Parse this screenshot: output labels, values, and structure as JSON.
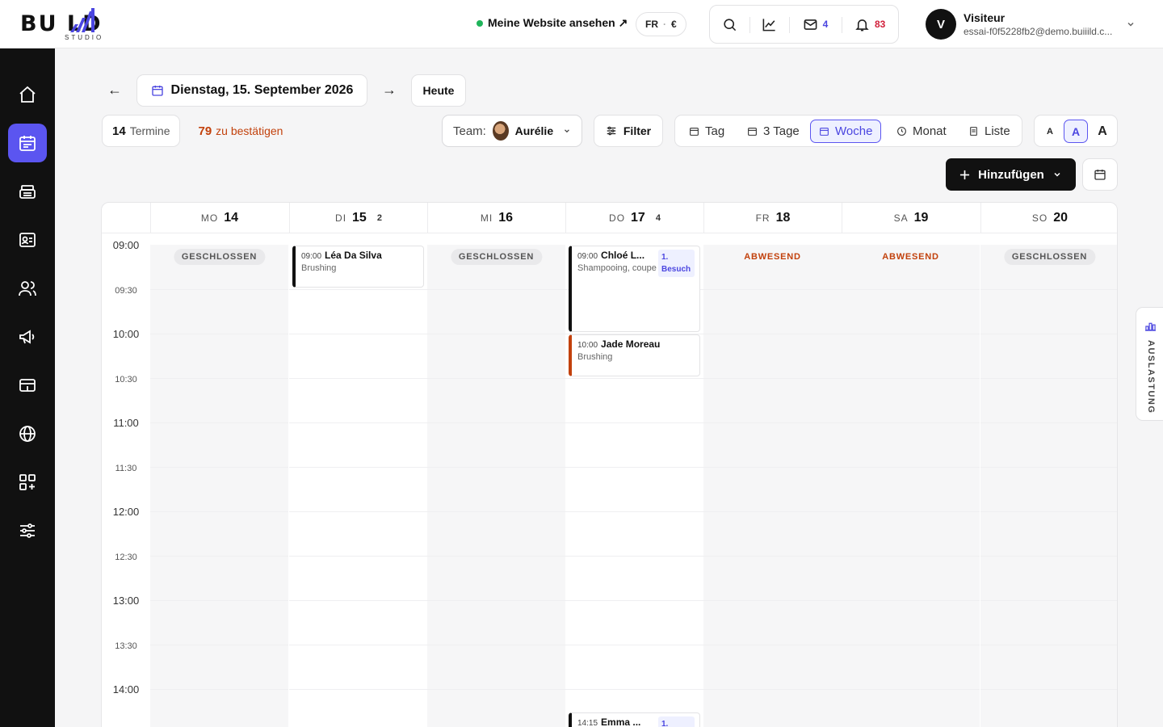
{
  "header": {
    "logo_text": "BU  LD",
    "logo_sub": "STUDIO",
    "site_link": "Meine Website ansehen ↗",
    "lang": "FR",
    "currency": "€",
    "mail_count": "4",
    "notif_count": "83",
    "user_initial": "V",
    "user_name": "Visiteur",
    "user_email": "essai-f0f5228fb2@demo.buiiild.c..."
  },
  "sidebar": {
    "items": [
      {
        "icon": "home-icon"
      },
      {
        "icon": "calendar-icon",
        "active": true
      },
      {
        "icon": "register-icon"
      },
      {
        "icon": "contact-card-icon"
      },
      {
        "icon": "users-icon"
      },
      {
        "icon": "megaphone-icon"
      },
      {
        "icon": "payment-card-icon"
      },
      {
        "icon": "globe-icon"
      },
      {
        "icon": "apps-add-icon"
      },
      {
        "icon": "settings-sliders-icon"
      }
    ]
  },
  "toolbar": {
    "prev": "←",
    "next": "→",
    "date_label": "Dienstag, 15. September 2026",
    "today_label": "Heute",
    "appointments_count": "14",
    "appointments_label": "Termine",
    "pending_count": "79",
    "pending_label": "zu bestätigen",
    "team_label": "Team:",
    "team_value": "Aurélie",
    "filter_label": "Filter",
    "views": [
      "Tag",
      "3 Tage",
      "Woche",
      "Monat",
      "Liste"
    ],
    "active_view": "Woche",
    "sizes": [
      "A",
      "A",
      "A"
    ],
    "add_label": "Hinzufügen"
  },
  "calendar": {
    "days": [
      {
        "name": "MO",
        "num": "14",
        "count": "",
        "status": "GESCHLOSSEN",
        "type": "closed"
      },
      {
        "name": "DI",
        "num": "15",
        "count": "2",
        "status": "",
        "type": "open"
      },
      {
        "name": "MI",
        "num": "16",
        "count": "",
        "status": "GESCHLOSSEN",
        "type": "closed"
      },
      {
        "name": "DO",
        "num": "17",
        "count": "4",
        "status": "",
        "type": "open"
      },
      {
        "name": "FR",
        "num": "18",
        "count": "",
        "status": "ABWESEND",
        "type": "absent"
      },
      {
        "name": "SA",
        "num": "19",
        "count": "",
        "status": "ABWESEND",
        "type": "absent"
      },
      {
        "name": "SO",
        "num": "20",
        "count": "",
        "status": "GESCHLOSSEN",
        "type": "closed"
      }
    ],
    "times": [
      "09:00",
      "09:30",
      "10:00",
      "10:30",
      "11:00",
      "11:30",
      "12:00",
      "12:30",
      "13:00",
      "13:30",
      "14:00"
    ],
    "appointments": [
      {
        "day": 1,
        "start": "09:00",
        "duration_min": 30,
        "time": "09:00",
        "name": "Léa Da Silva",
        "service": "Brushing",
        "tag": "",
        "color": "#111111"
      },
      {
        "day": 3,
        "start": "09:00",
        "duration_min": 60,
        "time": "09:00",
        "name": "Chloé L...",
        "service": "Shampooing, coupe & brus...",
        "tag": "1. Besuch",
        "color": "#111111"
      },
      {
        "day": 3,
        "start": "10:00",
        "duration_min": 30,
        "time": "10:00",
        "name": "Jade Moreau",
        "service": "Brushing",
        "tag": "",
        "color": "#c2410c"
      },
      {
        "day": 3,
        "start": "14:15",
        "duration_min": 30,
        "time": "14:15",
        "name": "Emma ...",
        "service": "",
        "tag": "1.",
        "color": "#111111"
      }
    ]
  },
  "side_tab": {
    "label": "AUSLASTUNG"
  }
}
